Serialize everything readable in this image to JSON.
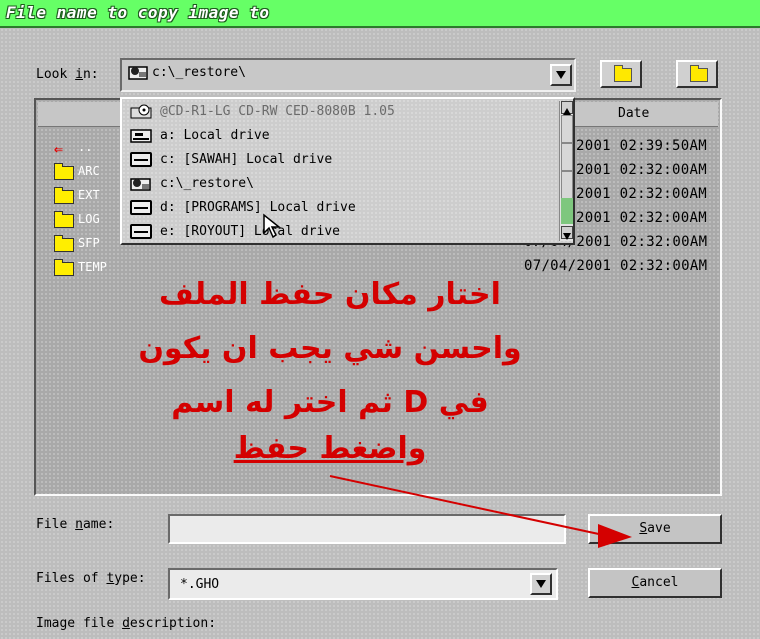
{
  "dialog": {
    "title": "File name to copy image to",
    "look_in_label_pre": "Look ",
    "look_in_label_u": "i",
    "look_in_label_post": "n:",
    "look_in_value": "c:\\_restore\\",
    "file_list": {
      "date_header": "Date",
      "rows": [
        {
          "name": "..",
          "date": "2001 02:39:50AM",
          "kind": "up"
        },
        {
          "name": "ARC",
          "date": "2001 02:32:00AM",
          "kind": "folder"
        },
        {
          "name": "EXT",
          "date": "2001 02:32:00AM",
          "kind": "folder"
        },
        {
          "name": "LOG",
          "date": "2001 02:32:00AM",
          "kind": "folder"
        },
        {
          "name": "SFP",
          "date": "07/04/2001 02:32:00AM",
          "kind": "folder"
        },
        {
          "name": "TEMP",
          "date": "07/04/2001 02:32:00AM",
          "kind": "folder"
        }
      ]
    },
    "dropdown_items": [
      {
        "label": "@CD-R1-LG     CD-RW CED-8080B 1.05",
        "icon": "cd-drive-icon",
        "disabled": true
      },
      {
        "label": "a: Local drive",
        "icon": "floppy-drive-icon",
        "disabled": false
      },
      {
        "label": "c: [SAWAH] Local drive",
        "icon": "hard-drive-icon",
        "disabled": false
      },
      {
        "label": "c:\\_restore\\",
        "icon": "restore-folder-icon",
        "disabled": false
      },
      {
        "label": "d: [PROGRAMS] Local drive",
        "icon": "hard-drive-icon",
        "disabled": false
      },
      {
        "label": "e: [ROYOUT] Local drive",
        "icon": "hard-drive-icon",
        "disabled": false
      }
    ],
    "file_name_label_pre": "File ",
    "file_name_label_u": "n",
    "file_name_label_post": "ame:",
    "file_name_value": "",
    "files_of_type_label_pre": "Files of ",
    "files_of_type_label_u": "t",
    "files_of_type_label_post": "ype:",
    "files_of_type_value": "*.GHO",
    "image_desc_label_pre": "Image file ",
    "image_desc_label_u": "d",
    "image_desc_label_post": "escription:",
    "save_u": "S",
    "save_rest": "ave",
    "cancel_u": "C",
    "cancel_rest": "ancel"
  },
  "annotation": {
    "line1": "اختار مكان حفظ الملف",
    "line2": "واحسن شي يجب ان يكون",
    "line3": "في D ثم اختر له اسم",
    "line4": "واضغط حفظ",
    "color": "#d40000"
  },
  "colors": {
    "titlebar": "#66ff66",
    "scroll_thumb": "#7ec77e"
  }
}
